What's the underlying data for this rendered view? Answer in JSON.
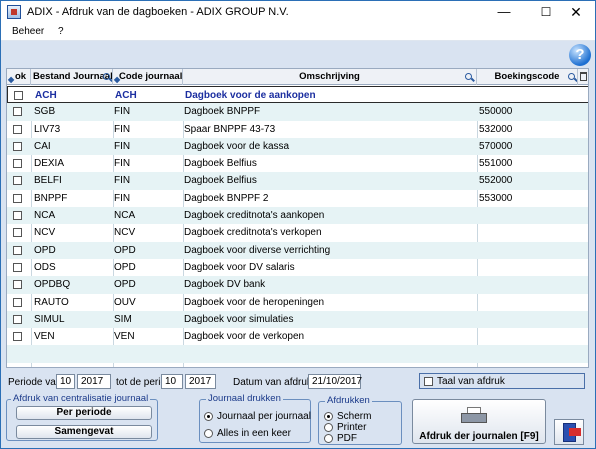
{
  "window": {
    "title": "ADIX - Afdruk van de dagboeken - ADIX GROUP N.V.",
    "minimize": "—",
    "maximize": "☐",
    "close": "✕"
  },
  "menu": {
    "beheer": "Beheer",
    "help": "?"
  },
  "help_button": "?",
  "grid": {
    "headers": {
      "ok": "ok",
      "bestand": "Bestand Journaal",
      "code": "Code journaal",
      "omschrijving": "Omschrijving",
      "boekingscode": "Boekingscode"
    },
    "rows": [
      {
        "bestand": "ACH",
        "code": "ACH",
        "omschrijving": "Dagboek voor de aankopen",
        "boekingscode": ""
      },
      {
        "bestand": "SGB",
        "code": "FIN",
        "omschrijving": "Dagboek BNPPF",
        "boekingscode": "550000"
      },
      {
        "bestand": "LIV73",
        "code": "FIN",
        "omschrijving": "Spaar BNPPF 43-73",
        "boekingscode": "532000"
      },
      {
        "bestand": "CAI",
        "code": "FIN",
        "omschrijving": "Dagboek voor de kassa",
        "boekingscode": "570000"
      },
      {
        "bestand": "DEXIA",
        "code": "FIN",
        "omschrijving": "Dagboek Belfius",
        "boekingscode": "551000"
      },
      {
        "bestand": "BELFI",
        "code": "FIN",
        "omschrijving": "Dagboek Belfius",
        "boekingscode": "552000"
      },
      {
        "bestand": "BNPPF",
        "code": "FIN",
        "omschrijving": "Dagboek BNPPF 2",
        "boekingscode": "553000"
      },
      {
        "bestand": "NCA",
        "code": "NCA",
        "omschrijving": "Dagboek creditnota's aankopen",
        "boekingscode": ""
      },
      {
        "bestand": "NCV",
        "code": "NCV",
        "omschrijving": "Dagboek creditnota's verkopen",
        "boekingscode": ""
      },
      {
        "bestand": "OPD",
        "code": "OPD",
        "omschrijving": "Dagboek voor diverse verrichting",
        "boekingscode": ""
      },
      {
        "bestand": "ODS",
        "code": "OPD",
        "omschrijving": "Dagboek voor DV salaris",
        "boekingscode": ""
      },
      {
        "bestand": "OPDBQ",
        "code": "OPD",
        "omschrijving": "Dagboek DV bank",
        "boekingscode": ""
      },
      {
        "bestand": "RAUTO",
        "code": "OUV",
        "omschrijving": "Dagboek voor de heropeningen",
        "boekingscode": ""
      },
      {
        "bestand": "SIMUL",
        "code": "SIM",
        "omschrijving": "Dagboek voor simulaties",
        "boekingscode": ""
      },
      {
        "bestand": "VEN",
        "code": "VEN",
        "omschrijving": "Dagboek voor de verkopen",
        "boekingscode": ""
      }
    ],
    "empty_rows": 2
  },
  "periode": {
    "van_label": "Periode van",
    "van_month": "10",
    "van_year": "2017",
    "tot_label": "tot de perio",
    "tot_month": "10",
    "tot_year": "2017"
  },
  "datum": {
    "label": "Datum van afdruk",
    "value": "21/10/2017"
  },
  "taal": {
    "label": "Taal van afdruk",
    "checked": false
  },
  "centralisatie": {
    "title": "Afdruk van centralisatie journaal",
    "per_periode": "Per periode",
    "samengevat": "Samengevat"
  },
  "journaal_drukken": {
    "title": "Journaal drukken",
    "options": [
      "Journaal per journaal",
      "Alles in een keer"
    ],
    "selected": 0
  },
  "afdrukken": {
    "title": "Afdrukken",
    "options": [
      "Scherm",
      "Printer",
      "PDF"
    ],
    "selected": 0
  },
  "print_button": "Afdruk der journalen [F9]",
  "colors": {
    "accent": "#2b6fb6",
    "selected_row_text": "#1b2ea0",
    "alt_row": "#e6f3f5",
    "background": "#d9e3f1"
  }
}
